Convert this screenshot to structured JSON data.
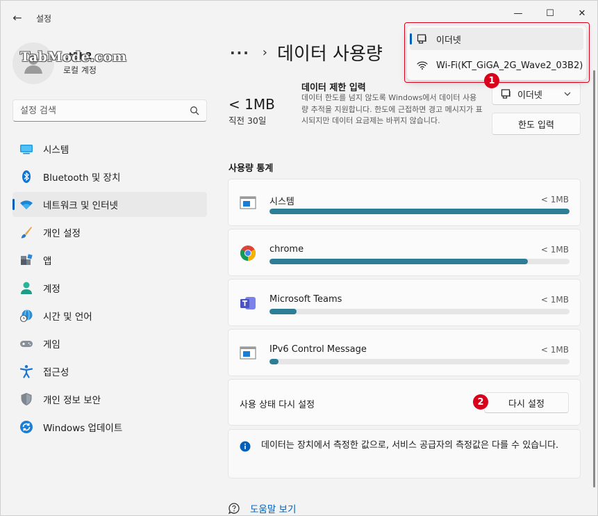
{
  "titlebar": {
    "app_title": "설정",
    "back_glyph": "←",
    "minimize_glyph": "—",
    "maximize_glyph": "☐",
    "close_glyph": "✕"
  },
  "profile": {
    "watermark": "TabMode.com",
    "name": "ct2b2",
    "account_type": "로컬 계정"
  },
  "search": {
    "placeholder": "설정 검색"
  },
  "nav": {
    "items": [
      {
        "label": "시스템",
        "icon": "system-icon"
      },
      {
        "label": "Bluetooth 및 장치",
        "icon": "bluetooth-icon"
      },
      {
        "label": "네트워크 및 인터넷",
        "icon": "wifi-icon",
        "active": true
      },
      {
        "label": "개인 설정",
        "icon": "brush-icon"
      },
      {
        "label": "앱",
        "icon": "apps-icon"
      },
      {
        "label": "계정",
        "icon": "account-icon"
      },
      {
        "label": "시간 및 언어",
        "icon": "globe-clock-icon"
      },
      {
        "label": "게임",
        "icon": "gamepad-icon"
      },
      {
        "label": "접근성",
        "icon": "accessibility-icon"
      },
      {
        "label": "개인 정보 보안",
        "icon": "shield-icon"
      },
      {
        "label": "Windows 업데이트",
        "icon": "update-icon"
      }
    ]
  },
  "header": {
    "more": "···",
    "separator": "›",
    "title": "데이터 사용량"
  },
  "usage": {
    "total": "< 1MB",
    "period": "직전 30일"
  },
  "limit": {
    "title": "데이터 제한 입력",
    "description": "데이터 한도를 넘지 않도록 Windows에서 데이터 사용량 추적을 지원합니다. 한도에 근접하면 경고 메시지가 표시되지만 데이터 요금제는 바뀌지 않습니다.",
    "network_dropdown": "이더넷",
    "enter_limit_button": "한도 입력"
  },
  "stats": {
    "title": "사용량 통계",
    "apps": [
      {
        "name": "시스템",
        "amount": "< 1MB",
        "fill": 1.0,
        "icon": "system-window-icon"
      },
      {
        "name": "chrome",
        "amount": "< 1MB",
        "fill": 0.86,
        "icon": "chrome-icon"
      },
      {
        "name": "Microsoft Teams",
        "amount": "< 1MB",
        "fill": 0.09,
        "icon": "teams-icon"
      },
      {
        "name": "IPv6 Control Message",
        "amount": "< 1MB",
        "fill": 0.03,
        "icon": "system-window-icon"
      }
    ]
  },
  "reset": {
    "label": "사용 상태 다시 설정",
    "button": "다시 설정"
  },
  "info": {
    "text": "데이터는 장치에서 측정한 값으로, 서비스 공급자의 측정값은 다를 수 있습니다."
  },
  "help": {
    "link": "도움말 보기"
  },
  "popup": {
    "items": [
      {
        "label": "이더넷",
        "icon": "ethernet-icon",
        "selected": true
      },
      {
        "label": "Wi-Fi(KT_GiGA_2G_Wave2_03B2)",
        "icon": "wifi-icon",
        "selected": false
      }
    ]
  },
  "badges": {
    "one": "1",
    "two": "2"
  },
  "colors": {
    "accent": "#005fb8",
    "bar_fill": "#2e7d96",
    "annotation_red": "#d9001b"
  }
}
